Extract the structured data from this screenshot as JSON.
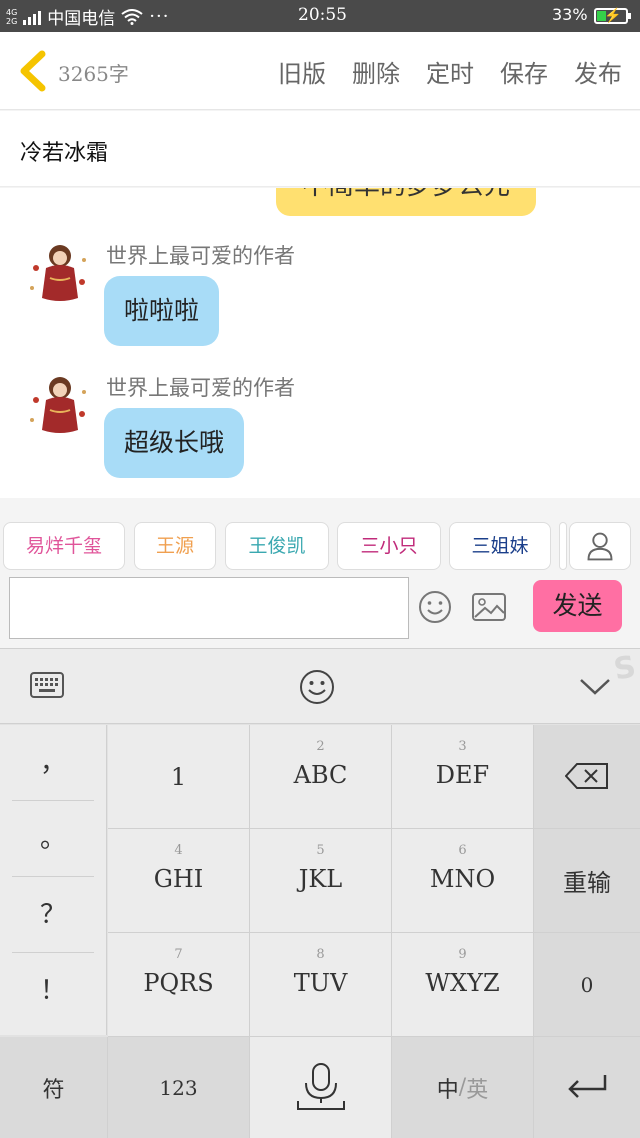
{
  "status_bar": {
    "network_tag_top": "4G",
    "network_tag_bottom": "2G",
    "carrier": "中国电信",
    "more": "···",
    "time": "20:55",
    "battery_percent": "33%",
    "battery_level": 0.33,
    "battery_color": "#35d04a"
  },
  "header": {
    "word_count": "3265字",
    "actions": [
      "旧版",
      "删除",
      "定时",
      "保存",
      "发布"
    ],
    "back_color": "#f5c400"
  },
  "title_row": {
    "title": "冷若冰霜"
  },
  "chat": {
    "my_bubble_text": "不简单的梦梦公元",
    "messages": [
      {
        "sender": "世界上最可爱的作者",
        "text": "啦啦啦"
      },
      {
        "sender": "世界上最可爱的作者",
        "text": "超级长哦"
      }
    ],
    "my_bubble_color": "#ffe070",
    "their_bubble_color": "#a8dcf7"
  },
  "chips": [
    {
      "label": "易烊千玺",
      "color": "#e0559a"
    },
    {
      "label": "王源",
      "color": "#f0a050"
    },
    {
      "label": "王俊凯",
      "color": "#3aa8b0"
    },
    {
      "label": "三小只",
      "color": "#c02a7a"
    },
    {
      "label": "三姐妹",
      "color": "#1a3e8a"
    }
  ],
  "input": {
    "value": "",
    "placeholder": "",
    "send_label": "发送",
    "send_color": "#ff6fa3"
  },
  "keyboard": {
    "punctuation": [
      "，",
      "。",
      "？",
      "！"
    ],
    "keys": [
      {
        "num": "",
        "label": "1"
      },
      {
        "num": "2",
        "label": "ABC"
      },
      {
        "num": "3",
        "label": "DEF"
      },
      {
        "num": "4",
        "label": "GHI"
      },
      {
        "num": "5",
        "label": "JKL"
      },
      {
        "num": "6",
        "label": "MNO"
      },
      {
        "num": "7",
        "label": "PQRS"
      },
      {
        "num": "8",
        "label": "TUV"
      },
      {
        "num": "9",
        "label": "WXYZ"
      }
    ],
    "retype": "重输",
    "zero": "0",
    "symbols": "符",
    "numbers": "123",
    "lang_cn": "中",
    "lang_sep": "/",
    "lang_en": "英"
  }
}
